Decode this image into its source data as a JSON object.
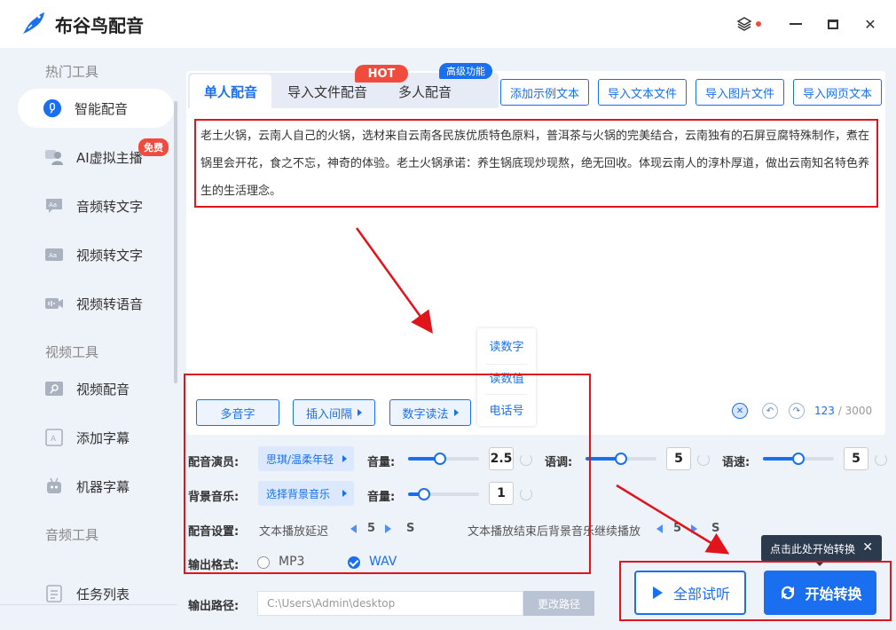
{
  "app": {
    "title": "布谷鸟配音"
  },
  "sidebar": {
    "sections": [
      "热门工具",
      "视频工具",
      "音频工具"
    ],
    "items": [
      {
        "label": "智能配音",
        "icon": "mic-icon"
      },
      {
        "label": "AI虚拟主播",
        "icon": "avatar-icon",
        "badge": "免费"
      },
      {
        "label": "音频转文字",
        "icon": "audio-text-icon"
      },
      {
        "label": "视频转文字",
        "icon": "video-text-icon"
      },
      {
        "label": "视频转语音",
        "icon": "video-voice-icon"
      },
      {
        "label": "视频配音",
        "icon": "video-dub-icon"
      },
      {
        "label": "添加字幕",
        "icon": "subtitle-icon"
      },
      {
        "label": "机器字幕",
        "icon": "robot-icon"
      },
      {
        "label": "任务列表",
        "icon": "task-list-icon"
      }
    ]
  },
  "tabs": [
    {
      "label": "单人配音",
      "active": true
    },
    {
      "label": "导入文件配音"
    },
    {
      "label": "多人配音"
    }
  ],
  "tab_badges": {
    "hot": "HOT",
    "pro": "高级功能"
  },
  "actions": [
    "添加示例文本",
    "导入文本文件",
    "导入图片文件",
    "导入网页文本"
  ],
  "editor": {
    "text": "老土火锅，云南人自己的火锅，选材来自云南各民族优质特色原料，普洱茶与火锅的完美结合，云南独有的石屏豆腐特殊制作，煮在锅里会开花，食之不忘，神奇的体验。老土火锅承诺：养生锅底现炒现熬，绝无回收。体现云南人的淳朴厚道，做出云南知名特色养生的生活理念。",
    "count": "123",
    "max": "/ 3000"
  },
  "number_menu": [
    "读数字",
    "读数值",
    "电话号"
  ],
  "tools": [
    "多音字",
    "插入间隔",
    "数字读法"
  ],
  "settings": {
    "voice_label": "配音演员:",
    "voice_value": "思琪/温柔年轻",
    "volume_label": "音量:",
    "volume_value": "2.5",
    "volume_fraction": 0.45,
    "pitch_label": "语调:",
    "pitch_value": "5",
    "pitch_fraction": 0.5,
    "speed_label": "语速:",
    "speed_value": "5",
    "speed_fraction": 0.5,
    "bgm_label": "背景音乐:",
    "bgm_value": "选择背景音乐",
    "bgm_volume_label": "音量:",
    "bgm_volume_value": "1",
    "bgm_volume_fraction": 0.22,
    "dub_label": "配音设置:",
    "delay_label": "文本播放延迟",
    "delay_value": "5",
    "delay_unit": "S",
    "continue_label": "文本播放结束后背景音乐继续播放",
    "continue_value": "5",
    "continue_unit": "S",
    "format_label": "输出格式:",
    "format_options": [
      "MP3",
      "WAV"
    ],
    "format_selected": "WAV",
    "path_label": "输出路径:",
    "path_value": "C:\\Users\\Admin\\desktop",
    "path_button": "更改路径"
  },
  "buttons": {
    "preview": "全部试听",
    "start": "开始转换"
  },
  "tooltip": {
    "text": "点击此处开始转换"
  },
  "colors": {
    "accent": "#1a6ff0",
    "annotation": "#e0141a",
    "hot": "#f04b3d"
  }
}
